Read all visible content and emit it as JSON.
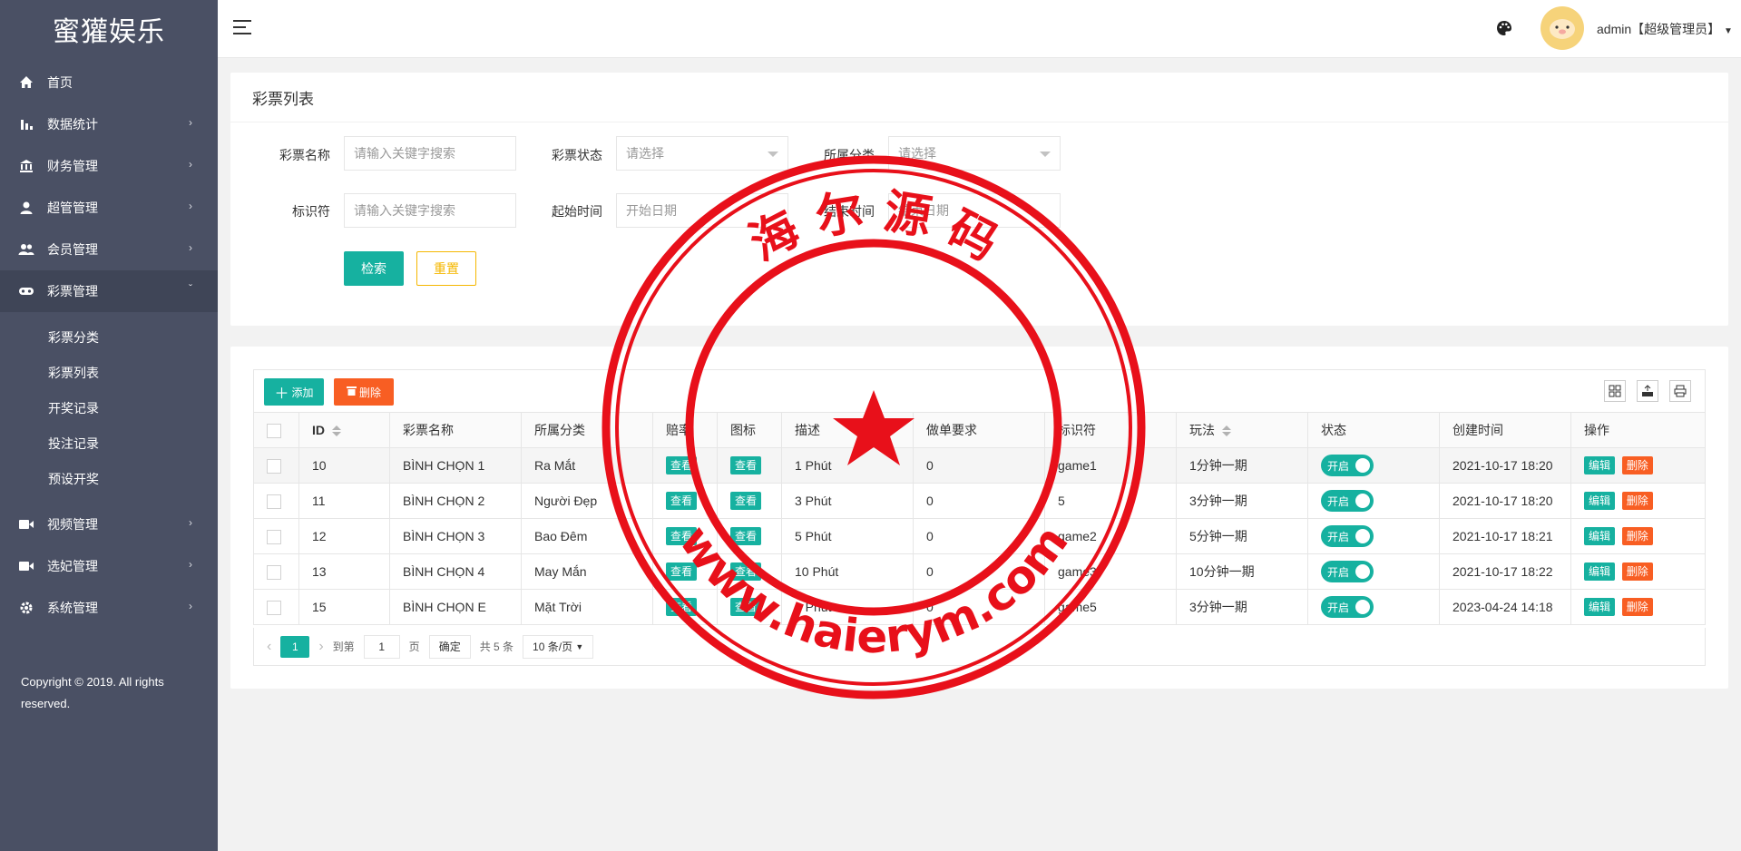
{
  "app": {
    "title": "蜜獾娱乐"
  },
  "sidebar": {
    "items": [
      {
        "label": "首页",
        "icon": "home-icon",
        "has_children": false
      },
      {
        "label": "数据统计",
        "icon": "bar-chart-icon",
        "has_children": true
      },
      {
        "label": "财务管理",
        "icon": "bank-icon",
        "has_children": true
      },
      {
        "label": "超管管理",
        "icon": "user-icon",
        "has_children": true
      },
      {
        "label": "会员管理",
        "icon": "users-icon",
        "has_children": true
      },
      {
        "label": "彩票管理",
        "icon": "gamepad-icon",
        "has_children": true,
        "expanded": true
      },
      {
        "label": "视频管理",
        "icon": "video-icon",
        "has_children": true
      },
      {
        "label": "选妃管理",
        "icon": "video-icon",
        "has_children": true
      },
      {
        "label": "系统管理",
        "icon": "gear-icon",
        "has_children": true
      }
    ],
    "sub_items": [
      "彩票分类",
      "彩票列表",
      "开奖记录",
      "投注记录",
      "预设开奖"
    ],
    "copyright": "Copyright © 2019. All rights reserved."
  },
  "header": {
    "user": "admin【超级管理员】"
  },
  "search": {
    "title": "彩票列表",
    "name_label": "彩票名称",
    "name_placeholder": "请输入关键字搜索",
    "status_label": "彩票状态",
    "status_value": "请选择",
    "category_label": "所属分类",
    "category_value": "请选择",
    "key_label": "标识符",
    "key_placeholder": "请输入关键字搜索",
    "start_label": "起始时间",
    "start_placeholder": "开始日期",
    "end_label": "结束时间",
    "end_placeholder": "结束日期",
    "search_btn": "检索",
    "reset_btn": "重置"
  },
  "toolbar": {
    "add": "添加",
    "delete": "删除"
  },
  "table": {
    "columns": [
      "ID",
      "彩票名称",
      "所属分类",
      "赔率",
      "图标",
      "描述",
      "做单要求",
      "标识符",
      "玩法",
      "状态",
      "创建时间",
      "操作"
    ],
    "view_label": "查看",
    "status_on": "开启",
    "edit_label": "编辑",
    "del_label": "删除",
    "rows": [
      {
        "id": "10",
        "name": "BÌNH CHỌN 1",
        "cat": "Ra Mắt",
        "desc": "1 Phút",
        "req": "0",
        "key": "game1",
        "play": "1分钟一期",
        "time": "2021-10-17 18:20"
      },
      {
        "id": "11",
        "name": "BÌNH CHỌN 2",
        "cat": "Người Đẹp",
        "desc": "3 Phút",
        "req": "0",
        "key": "5",
        "play": "3分钟一期",
        "time": "2021-10-17 18:20"
      },
      {
        "id": "12",
        "name": "BÌNH CHỌN 3",
        "cat": "Bao Đêm",
        "desc": "5 Phút",
        "req": "0",
        "key": "game2",
        "play": "5分钟一期",
        "time": "2021-10-17 18:21"
      },
      {
        "id": "13",
        "name": "BÌNH CHỌN 4",
        "cat": "May Mắn",
        "desc": "10 Phút",
        "req": "0",
        "key": "game3",
        "play": "10分钟一期",
        "time": "2021-10-17 18:22"
      },
      {
        "id": "15",
        "name": "BÌNH CHỌN E",
        "cat": "Mặt Trời",
        "desc": "3 Phút",
        "req": "0",
        "key": "game5",
        "play": "3分钟一期",
        "time": "2023-04-24 14:18"
      }
    ]
  },
  "pager": {
    "current": "1",
    "goto": "到第",
    "page_input": "1",
    "page_unit": "页",
    "confirm": "确定",
    "total": "共 5 条",
    "size": "10 条/页"
  },
  "watermark": {
    "top_text": "海 尔 源 码",
    "bottom_text": "www.haierym.com",
    "color": "#e8101a"
  },
  "colors": {
    "sidebar": "#4a5064",
    "accent": "#16b1a0",
    "danger": "#f85e23",
    "warn": "#f5b700"
  }
}
